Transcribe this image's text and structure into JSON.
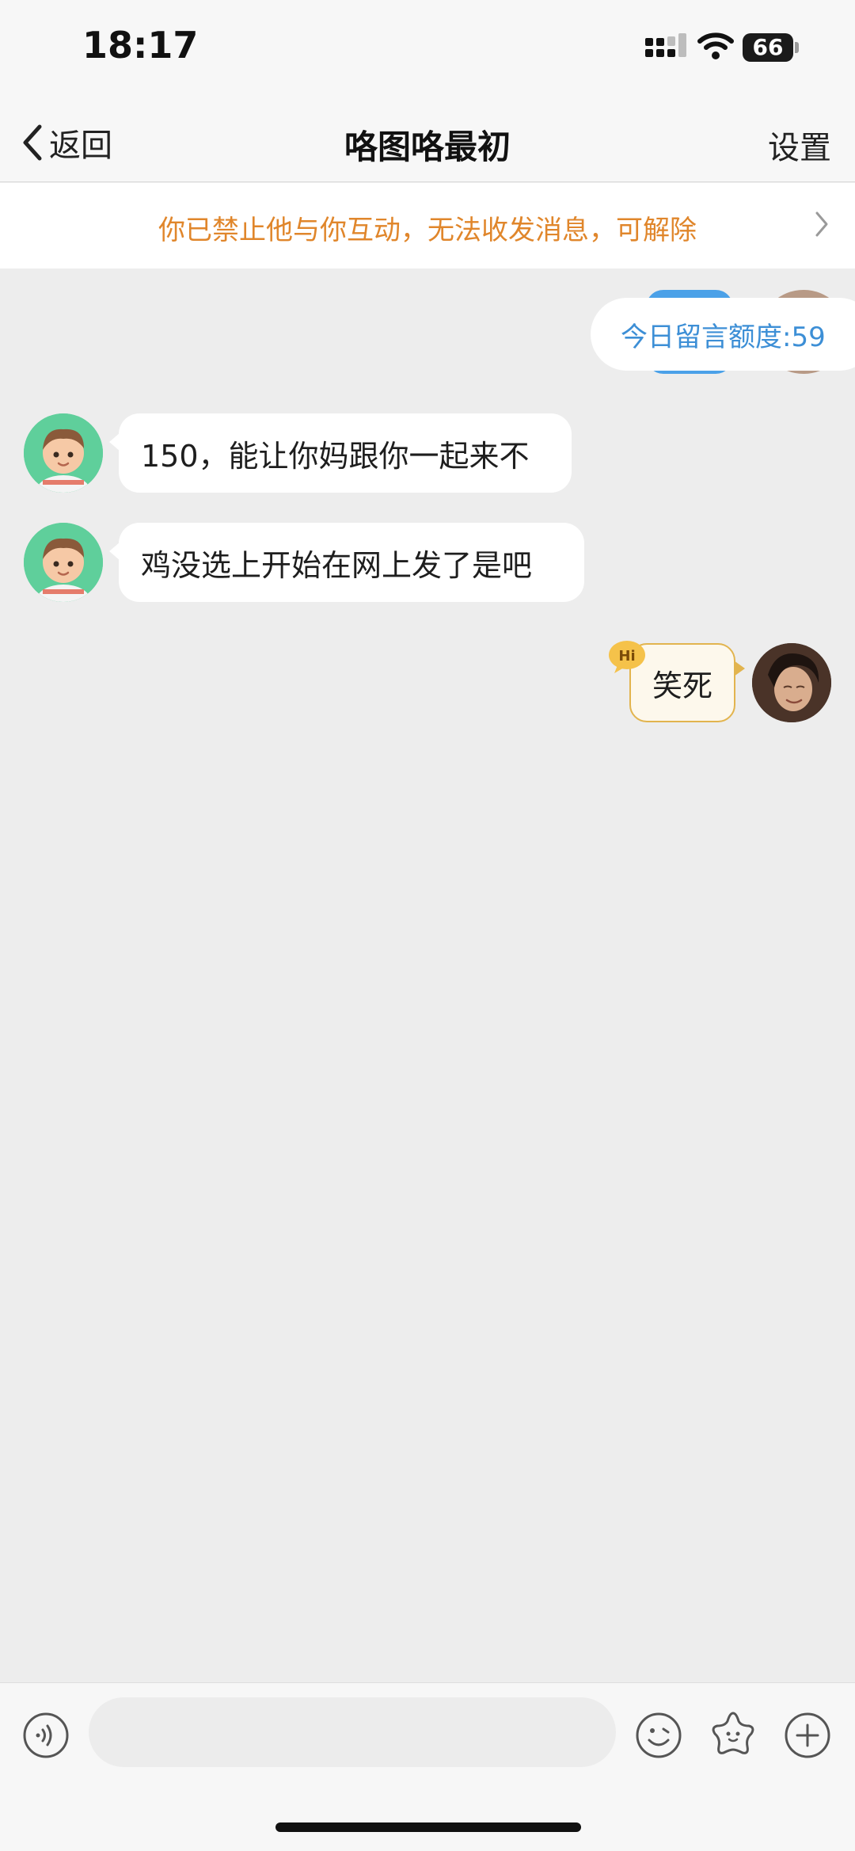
{
  "status_bar": {
    "time": "18:17",
    "battery": "66",
    "icons": [
      "signal-icon",
      "wifi-icon",
      "battery-icon"
    ]
  },
  "nav": {
    "back_label": "返回",
    "title": "咯图咯最初",
    "settings_label": "设置"
  },
  "notice": {
    "text": "你已禁止他与你互动，无法收发消息，可解除"
  },
  "quota": {
    "text": "今日留言额度:59"
  },
  "messages": [
    {
      "side": "left",
      "text": "150，能让你妈跟你一起来不"
    },
    {
      "side": "left",
      "text": "鸡没选上开始在网上发了是吧"
    },
    {
      "side": "right",
      "text": "笑死",
      "badge": "Hi"
    }
  ],
  "input_bar": {
    "placeholder": "",
    "icons": [
      "voice-icon",
      "emoji-icon",
      "sticker-icon",
      "plus-icon"
    ]
  },
  "colors": {
    "accent_notice": "#e0862b",
    "quota_text": "#3d8fd6",
    "background": "#ededed",
    "my_bubble_border": "#e2b44e"
  }
}
